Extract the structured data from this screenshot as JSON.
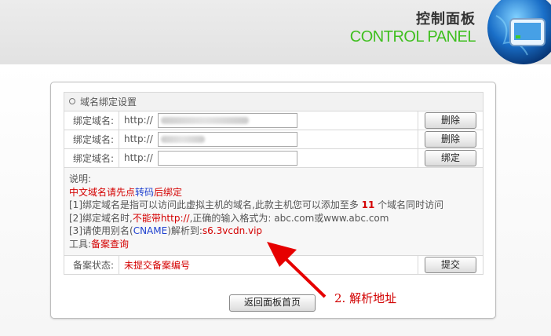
{
  "header": {
    "title_cn": "控制面板",
    "title_en": "CONTROL PANEL",
    "logo_icon": "globe-monitor-icon"
  },
  "domain_binding": {
    "section_title": "域名绑定设置",
    "rows": [
      {
        "label": "绑定域名:",
        "prefix": "http://",
        "value": "",
        "button": "删除"
      },
      {
        "label": "绑定域名:",
        "prefix": "http://",
        "value": "",
        "button": "删除"
      },
      {
        "label": "绑定域名:",
        "prefix": "http://",
        "value": "",
        "button": "绑定"
      }
    ]
  },
  "notes": {
    "heading": "说明:",
    "line1_a": "中文域名请先点",
    "line1_b": "转码",
    "line1_c": "后绑定",
    "line2_a": "[1]绑定域名是指可以访问此虚拟主机的域名,此款主机您可以添加至多 ",
    "line2_num": "11",
    "line2_b": " 个域名同时访问",
    "line3_a": "[2]绑定域名时,",
    "line3_b": "不能带http://",
    "line3_c": ",正确的输入格式为: abc.com或www.abc.com",
    "line4_a": "[3]请使用别名(",
    "line4_b": "CNAME",
    "line4_c": ")解析到:",
    "line4_d": "s6.3vcdn.vip",
    "line5_a": "工具:",
    "line5_b": "备案查询"
  },
  "record": {
    "label": "备案状态:",
    "value": "未提交备案编号",
    "button": "提交"
  },
  "back_button": "返回面板首页",
  "annotation": "2. 解析地址",
  "colors": {
    "accent_green": "#3fbf1f",
    "warning_red": "#d40000",
    "link_blue": "#1d3fcf"
  }
}
